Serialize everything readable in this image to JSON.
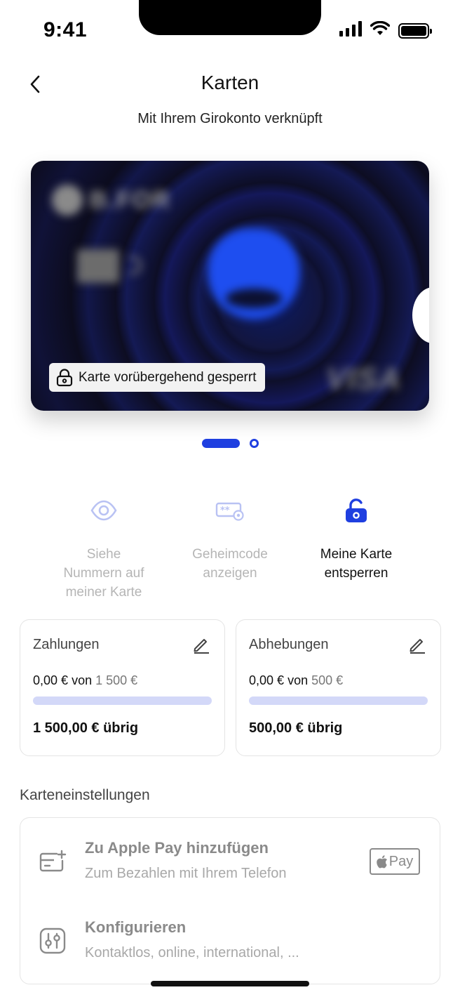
{
  "status_bar": {
    "time": "9:41"
  },
  "header": {
    "title": "Karten",
    "subtitle": "Mit Ihrem Girokonto verknüpft"
  },
  "card": {
    "brand_text": "B.FOR",
    "network": "VISA",
    "lock_badge": "Karte vorübergehend gesperrt"
  },
  "pager": {
    "current": 1,
    "total": 2
  },
  "actions": [
    {
      "label": "Siehe\nNummern auf\nmeiner Karte",
      "icon": "eye-icon"
    },
    {
      "label": "Geheimcode\nanzeigen",
      "icon": "pin-reveal-icon"
    },
    {
      "label": "Meine Karte\nentsperren",
      "icon": "unlock-icon"
    }
  ],
  "limits": {
    "payments": {
      "title": "Zahlungen",
      "used": "0,00 €",
      "of": "von",
      "max": "1 500 €",
      "progress": 0,
      "remaining": "1 500,00 € übrig"
    },
    "withdrawals": {
      "title": "Abhebungen",
      "used": "0,00 €",
      "of": "von",
      "max": "500 €",
      "progress": 0,
      "remaining": "500,00 € übrig"
    }
  },
  "settings": {
    "section_title": "Karteneinstellungen",
    "apple_pay": {
      "title": "Zu Apple Pay hinzufügen",
      "subtitle": "Zum Bezahlen mit Ihrem Telefon",
      "badge": "Pay"
    },
    "configure": {
      "title": "Konfigurieren",
      "subtitle": "Kontaktlos, online, international, ..."
    }
  },
  "colors": {
    "accent": "#1f3fe0",
    "progress_track": "#d3d8f8",
    "muted_text": "#b5b5b5"
  }
}
